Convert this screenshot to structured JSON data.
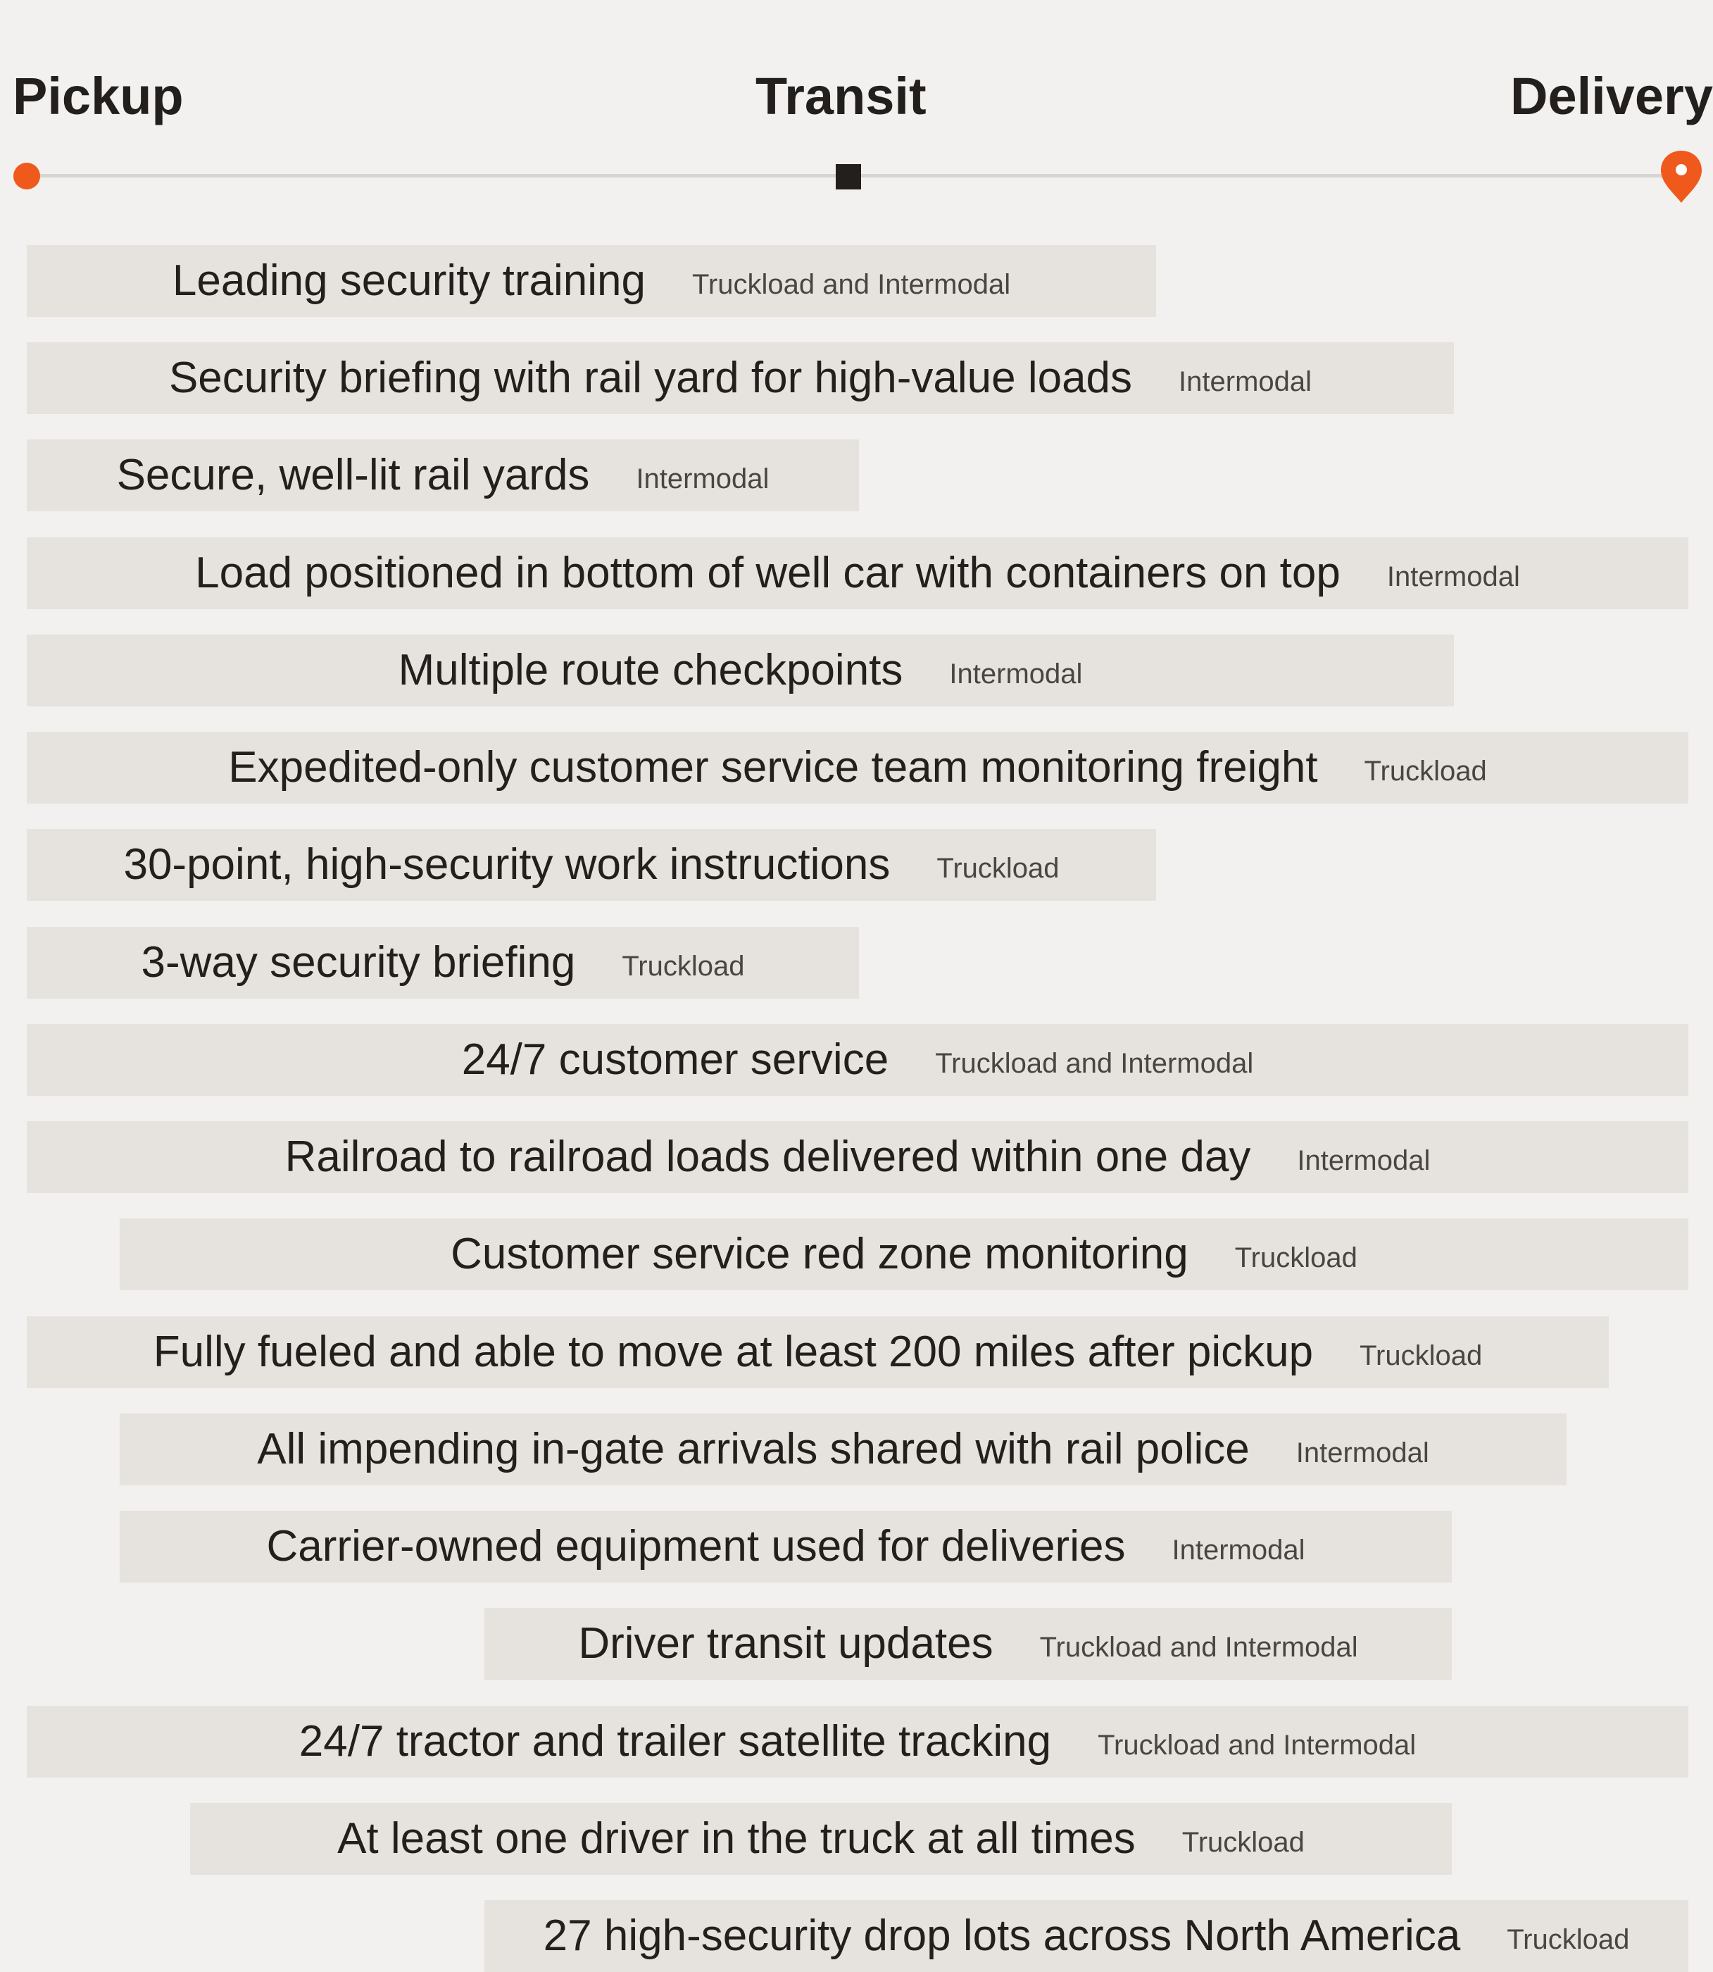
{
  "stages": {
    "pickup": "Pickup",
    "transit": "Transit",
    "delivery": "Delivery"
  },
  "colors": {
    "accent": "#f0591c",
    "text": "#231f1c",
    "bar": "#e6e3df",
    "background": "#f2f1ef",
    "track": "#d8d4cf"
  },
  "measures": [
    {
      "title": "Leading security training",
      "mode": "Truckload and Intermodal"
    },
    {
      "title": "Security briefing with rail yard for high-value loads",
      "mode": "Intermodal"
    },
    {
      "title": "Secure, well-lit rail yards",
      "mode": "Intermodal"
    },
    {
      "title": "Load positioned in bottom of well car with containers on top",
      "mode": "Intermodal"
    },
    {
      "title": "Multiple route checkpoints",
      "mode": "Intermodal"
    },
    {
      "title": "Expedited-only customer service team monitoring freight",
      "mode": "Truckload"
    },
    {
      "title": "30-point, high-security work instructions",
      "mode": "Truckload"
    },
    {
      "title": "3-way security briefing",
      "mode": "Truckload"
    },
    {
      "title": "24/7 customer service",
      "mode": "Truckload and Intermodal"
    },
    {
      "title": "Railroad to railroad loads delivered within one day",
      "mode": "Intermodal"
    },
    {
      "title": "Customer service red zone monitoring",
      "mode": "Truckload"
    },
    {
      "title": "Fully fueled and able to move at least 200 miles after pickup",
      "mode": "Truckload"
    },
    {
      "title": "All impending in-gate arrivals shared with rail police",
      "mode": "Intermodal"
    },
    {
      "title": "Carrier-owned equipment used for deliveries",
      "mode": "Intermodal"
    },
    {
      "title": "Driver transit updates",
      "mode": "Truckload and Intermodal"
    },
    {
      "title": "24/7 tractor and trailer satellite tracking",
      "mode": "Truckload and Intermodal"
    },
    {
      "title": "At least one driver in the truck at all times",
      "mode": "Truckload"
    },
    {
      "title": "27 high-security drop lots across North America",
      "mode": "Truckload"
    }
  ]
}
